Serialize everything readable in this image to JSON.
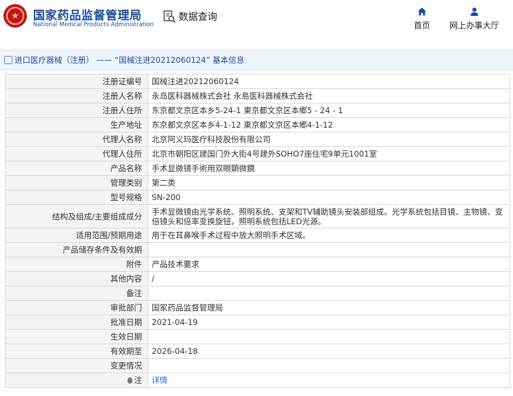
{
  "header": {
    "brand_cn": "国家药品监督管理局",
    "brand_en": "National Medical Products Administration",
    "query_label": "数据查询",
    "nav": {
      "home": "首页",
      "service_hall": "网上办事大厅"
    }
  },
  "breadcrumb": "进口医疗器械（注册） —— “国械注进20212060124” 基本信息",
  "rows": [
    {
      "k": "注册证编号",
      "v": "国械注进20212060124"
    },
    {
      "k": "注册人名称",
      "v": "永岛医科器械株式会社 永島医科器械株式会社"
    },
    {
      "k": "注册人住所",
      "v": "东京都文京区本乡5-24-1 東京都文京区本郷5 - 24 - 1"
    },
    {
      "k": "生产地址",
      "v": "东京都文京区本乡4-1-12 東京都文京区本郷4-1-12"
    },
    {
      "k": "代理人名称",
      "v": "北京阿义玛医疗科技股份有限公司"
    },
    {
      "k": "代理人住所",
      "v": "北京市朝阳区建国门外大街4号建外SOHO7座住宅9单元1001室"
    },
    {
      "k": "产品名称",
      "v": "手术显微镜手術用双眼顕微鏡"
    },
    {
      "k": "管理类别",
      "v": "第二类"
    },
    {
      "k": "型号规格",
      "v": "SN-200"
    },
    {
      "k": "结构及组成/主要组成成分",
      "v": "手术显微镜由光学系统、照明系统、支架和TV辅助镜头安装部组成。光学系统包括目镜、主物镜、变倍镜头和倍率变换旋钮，照明系统包括LED光源。"
    },
    {
      "k": "适用范围/预期用途",
      "v": "用于在耳鼻喉手术过程中放大照明手术区域。"
    },
    {
      "k": "产品储存条件及有效期",
      "v": ""
    },
    {
      "k": "附件",
      "v": "产品技术要求"
    },
    {
      "k": "其他内容",
      "v": "/"
    },
    {
      "k": "备注",
      "v": ""
    },
    {
      "k": "审批部门",
      "v": "国家药品监督管理局"
    },
    {
      "k": "批准日期",
      "v": "2021-04-19"
    },
    {
      "k": "生效日期",
      "v": ""
    },
    {
      "k": "有效期至",
      "v": "2026-04-18"
    },
    {
      "k": "变更情况",
      "v": ""
    }
  ],
  "note": {
    "k": "注",
    "link": "详情"
  },
  "colors": {
    "brand_blue": "#1f4e9c",
    "logo_red": "#c8102e",
    "link_blue": "#1f6fd1"
  },
  "icons": {
    "logo": "emblem-icon",
    "query": "search-doc-icon",
    "home": "home-icon",
    "hall": "user-icon"
  }
}
